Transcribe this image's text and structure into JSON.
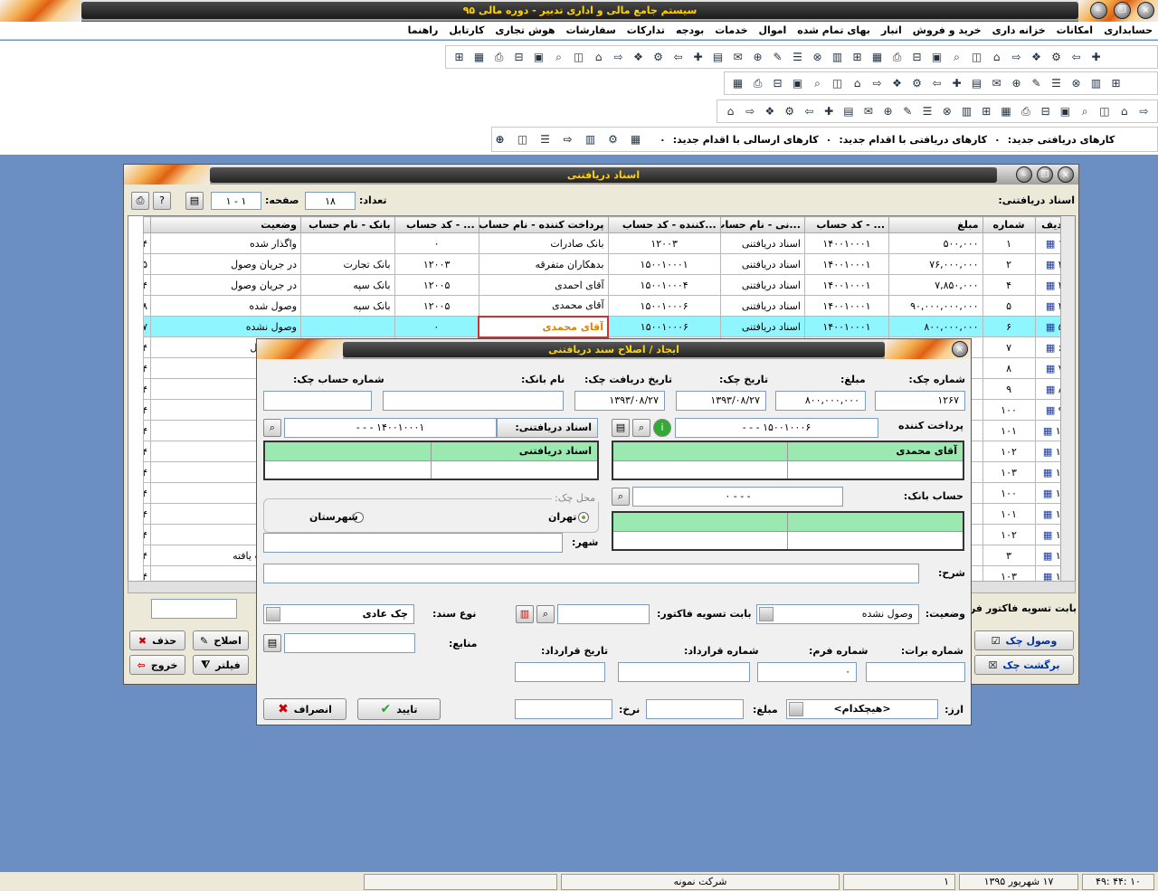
{
  "app": {
    "title": "سیستم جامع مالی و اداری تدبیر - دوره مالی ۹۵"
  },
  "menu": [
    "حسابداری",
    "امکانات",
    "خزانه داری",
    "خرید و فروش",
    "انبار",
    "بهای تمام شده",
    "اموال",
    "خدمات",
    "بودجه",
    "تدارکات",
    "سفارشات",
    "هوش تجاری",
    "کارتابل",
    "راهنما"
  ],
  "notifications": {
    "received_label": "کارهای دریافتی جدید:",
    "received_value": "۰",
    "received_action_label": "کارهای دریافتی با اقدام جدید:",
    "received_action_value": "۰",
    "sent_action_label": "کارهای ارسالی با اقدام جدید:",
    "sent_action_value": "۰"
  },
  "list_window": {
    "title": "اسناد دریافتنی",
    "filter_label": "اسناد دریافتنی:",
    "count_label": "تعداد:",
    "count_value": "۱۸",
    "page_label": "صفحه:",
    "page_value": "۱ - ۱",
    "columns": [
      "ردیف",
      "شماره",
      "مبلغ",
      "... - کد حساب",
      "...نی - نام حساب",
      "...کننده - کد حساب",
      "پرداخت کننده - نام حساب",
      "... - کد حساب",
      "بانک - نام حساب",
      "وضعیت"
    ],
    "rows": [
      {
        "radif": "۱",
        "shomare": "۱",
        "mablagh": "۵۰۰,۰۰۰",
        "kod1": "۱۴۰۰۱۰۰۰۱",
        "nam1": "اسناد دریافتنی",
        "kod2": "۱۲۰۰۳",
        "nam2": "بانک صادرات",
        "kod3": "۰",
        "bank": "",
        "vaziat": "واگذار شده",
        "extra": "۴"
      },
      {
        "radif": "۲",
        "shomare": "۲",
        "mablagh": "۷۶,۰۰۰,۰۰۰",
        "kod1": "۱۴۰۰۱۰۰۰۱",
        "nam1": "اسناد دریافتنی",
        "kod2": "۱۵۰۰۱۰۰۰۱",
        "nam2": "بدهکاران متفرقه",
        "kod3": "۱۲۰۰۳",
        "bank": "بانک تجارت",
        "vaziat": "در جریان وصول",
        "extra": "۵"
      },
      {
        "radif": "۳",
        "shomare": "۴",
        "mablagh": "۷,۸۵۰,۰۰۰",
        "kod1": "۱۴۰۰۱۰۰۰۱",
        "nam1": "اسناد دریافتنی",
        "kod2": "۱۵۰۰۱۰۰۰۴",
        "nam2": "آقای احمدی",
        "kod3": "۱۲۰۰۵",
        "bank": "بانک سپه",
        "vaziat": "در جریان وصول",
        "extra": "۴"
      },
      {
        "radif": "۴",
        "shomare": "۵",
        "mablagh": "۹۰,۰۰۰,۰۰۰,۰۰۰",
        "kod1": "۱۴۰۰۱۰۰۰۱",
        "nam1": "اسناد دریافتنی",
        "kod2": "۱۵۰۰۱۰۰۰۶",
        "nam2": "آقای محمدی",
        "kod3": "۱۲۰۰۵",
        "bank": "بانک سپه",
        "vaziat": "وصول شده",
        "extra": "۸"
      },
      {
        "radif": "۵",
        "shomare": "۶",
        "mablagh": "۸۰۰,۰۰۰,۰۰۰",
        "kod1": "۱۴۰۰۱۰۰۰۱",
        "nam1": "اسناد دریافتنی",
        "kod2": "۱۵۰۰۱۰۰۰۶",
        "nam2": "آقای محمدی",
        "kod3": "۰",
        "bank": "",
        "vaziat": "وصول نشده",
        "extra": "۷"
      },
      {
        "radif": "۶",
        "shomare": "۷",
        "vaziat": "ریان وصول",
        "extra": "۴"
      },
      {
        "radif": "۷",
        "shomare": "۸",
        "vaziat": "ل شده",
        "extra": "۴"
      },
      {
        "radif": "۸",
        "shomare": "۹",
        "vaziat": "ل نشده",
        "extra": "۴"
      },
      {
        "radif": "۹",
        "shomare": "۱۰۰",
        "vaziat": "ار شده",
        "extra": "۴"
      },
      {
        "radif": "۱۰",
        "shomare": "۱۰۱",
        "vaziat": "نتی",
        "extra": "۴"
      },
      {
        "radif": "۱۱",
        "shomare": "۱۰۲",
        "vaziat": "ل نشده",
        "extra": "۴"
      },
      {
        "radif": "۱۲",
        "shomare": "۱۰۳",
        "vaziat": "ل شده",
        "extra": "۴"
      },
      {
        "radif": "۱۳",
        "shomare": "۱۰۰",
        "vaziat": "ل نشده",
        "extra": "۴"
      },
      {
        "radif": "۱۴",
        "shomare": "۱۰۱",
        "vaziat": "ل نشده",
        "extra": "۴"
      },
      {
        "radif": "۱۵",
        "shomare": "۱۰۲",
        "vaziat": "ار شده",
        "extra": "۴"
      },
      {
        "radif": "۱۶",
        "shomare": "۳",
        "vaziat": "نتی عودت یافته",
        "extra": "۴"
      },
      {
        "radif": "۱۷",
        "shomare": "۱۰۳",
        "vaziat": "، شده",
        "extra": "۴"
      }
    ],
    "bottom_label": "بابت تسویه فاکتور فر",
    "buttons": {
      "vosool": "وصول چک",
      "bargasht": "برگشت چک",
      "eslah": "اصلاح",
      "hazf": "حذف",
      "filter": "فیلتر",
      "khorooj": "خروج"
    }
  },
  "dialog": {
    "title": "ایجاد / اصلاح سند دریافتنی",
    "check_no_label": "شماره چک:",
    "check_no": "۱۲۶۷",
    "amount_label": "مبلغ:",
    "amount": "۸۰۰,۰۰۰,۰۰۰",
    "check_date_label": "تاریخ چک:",
    "check_date": "۱۳۹۳/۰۸/۲۷",
    "receive_date_label": "تاریخ دریافت چک:",
    "receive_date": "۱۳۹۳/۰۸/۲۷",
    "bank_name_label": "نام بانک:",
    "bank_name": "",
    "account_no_label": "شماره حساب چک:",
    "account_no": "",
    "payer_label": "پرداخت کننده",
    "payer_code": "۱۵۰۰۱۰۰۰۶ - - -",
    "payer_name": "آقای محمدی",
    "receivable_label": "اسناد دریافتنی:",
    "receivable_code": "۱۴۰۰۱۰۰۰۱ - - -",
    "receivable_name": "اسناد دریافتنی",
    "bank_account_label": "حساب بانک:",
    "bank_account_code": "- - - ۰",
    "location_label": "محل چک:",
    "loc_tehran": "تهران",
    "loc_city": "شهرستان",
    "city_label": "شهر:",
    "city": "",
    "desc_label": "شرح:",
    "desc": "",
    "status_label": "وضعیت:",
    "status": "وصول نشده",
    "invoice_label": "بابت تسویه فاکتور:",
    "invoice": "",
    "doc_type_label": "نوع سند:",
    "doc_type": "چک عادی",
    "sources_label": "منابع:",
    "sources": "",
    "barat_label": "شماره برات:",
    "barat": "",
    "form_no_label": "شماره فرم:",
    "form_no": "۰",
    "contract_no_label": "شماره قرارداد:",
    "contract_no": "",
    "contract_date_label": "تاریخ قرارداد:",
    "contract_date": "",
    "currency_label": "ارز:",
    "currency": "<هیچکدام>",
    "cur_amount_label": "مبلغ:",
    "cur_amount": "",
    "rate_label": "نرخ:",
    "rate": "",
    "ok_label": "تایید",
    "cancel_label": "انصراف"
  },
  "status_bar": {
    "time": "۱۰ :۴۴ :۴۹",
    "date": "۱۷ شهریور ۱۳۹۵",
    "num": "۱",
    "company": "شرکت نمونه"
  }
}
